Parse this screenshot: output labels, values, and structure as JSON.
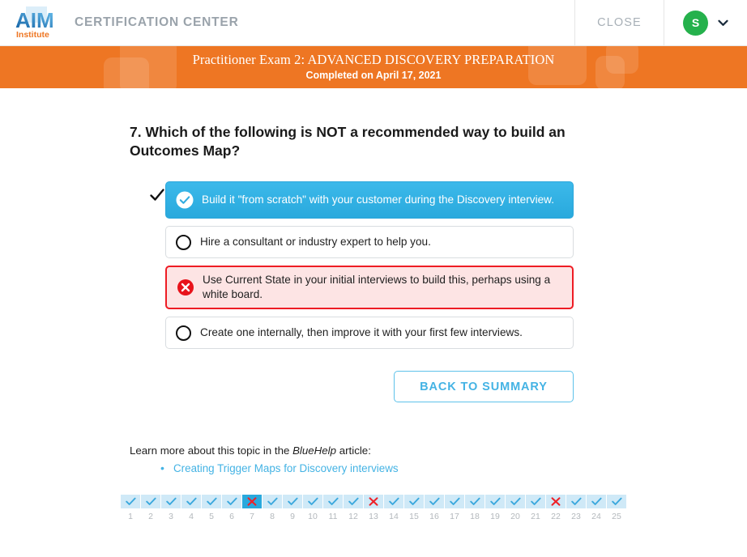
{
  "header": {
    "logo_alt": "AIM Institute",
    "logo_main": "AIM",
    "logo_sub": "Institute",
    "brand_title": "CERTIFICATION CENTER",
    "close_label": "CLOSE",
    "avatar_initial": "S",
    "accent_green": "#25b14c",
    "muted_gray": "#9aa3ab"
  },
  "banner": {
    "title": "Practitioner Exam 2: ADVANCED DISCOVERY PREPARATION",
    "subtitle": "Completed on April 17, 2021",
    "bg_color": "#ee7623"
  },
  "question": {
    "number": "7",
    "text": "7. Which of the following is NOT a recommended way to build an Outcomes Map?"
  },
  "options": [
    {
      "text": "Build it \"from scratch\" with your customer during the Discovery interview.",
      "state": "correct-answer",
      "icon": "check-circle-icon",
      "correct_tick": true
    },
    {
      "text": "Hire a consultant or industry expert to help you.",
      "state": "neutral",
      "icon": "radio-empty-icon",
      "correct_tick": false
    },
    {
      "text": "Use Current State in your initial interviews to build this, perhaps using a white board.",
      "state": "user-wrong",
      "icon": "x-circle-icon",
      "correct_tick": false
    },
    {
      "text": "Create one internally, then improve it with your first few interviews.",
      "state": "neutral",
      "icon": "radio-empty-icon",
      "correct_tick": false
    }
  ],
  "actions": {
    "back_label": "BACK TO SUMMARY",
    "accent_blue": "#44b3e4"
  },
  "learn_more": {
    "prefix": "Learn more about this topic in the ",
    "source": "BlueHelp",
    "suffix": " article:",
    "links": [
      "Creating Trigger Maps for Discovery interviews"
    ]
  },
  "nav": {
    "items": [
      {
        "num": "1",
        "result": "correct"
      },
      {
        "num": "2",
        "result": "correct"
      },
      {
        "num": "3",
        "result": "correct"
      },
      {
        "num": "4",
        "result": "correct"
      },
      {
        "num": "5",
        "result": "correct"
      },
      {
        "num": "6",
        "result": "correct"
      },
      {
        "num": "7",
        "result": "wrong",
        "active": true
      },
      {
        "num": "8",
        "result": "correct"
      },
      {
        "num": "9",
        "result": "correct"
      },
      {
        "num": "10",
        "result": "correct"
      },
      {
        "num": "11",
        "result": "correct"
      },
      {
        "num": "12",
        "result": "correct"
      },
      {
        "num": "13",
        "result": "wrong"
      },
      {
        "num": "14",
        "result": "correct"
      },
      {
        "num": "15",
        "result": "correct"
      },
      {
        "num": "16",
        "result": "correct"
      },
      {
        "num": "17",
        "result": "correct"
      },
      {
        "num": "18",
        "result": "correct"
      },
      {
        "num": "19",
        "result": "correct"
      },
      {
        "num": "20",
        "result": "correct"
      },
      {
        "num": "21",
        "result": "correct"
      },
      {
        "num": "22",
        "result": "wrong"
      },
      {
        "num": "23",
        "result": "correct"
      },
      {
        "num": "24",
        "result": "correct"
      },
      {
        "num": "25",
        "result": "correct"
      }
    ]
  }
}
